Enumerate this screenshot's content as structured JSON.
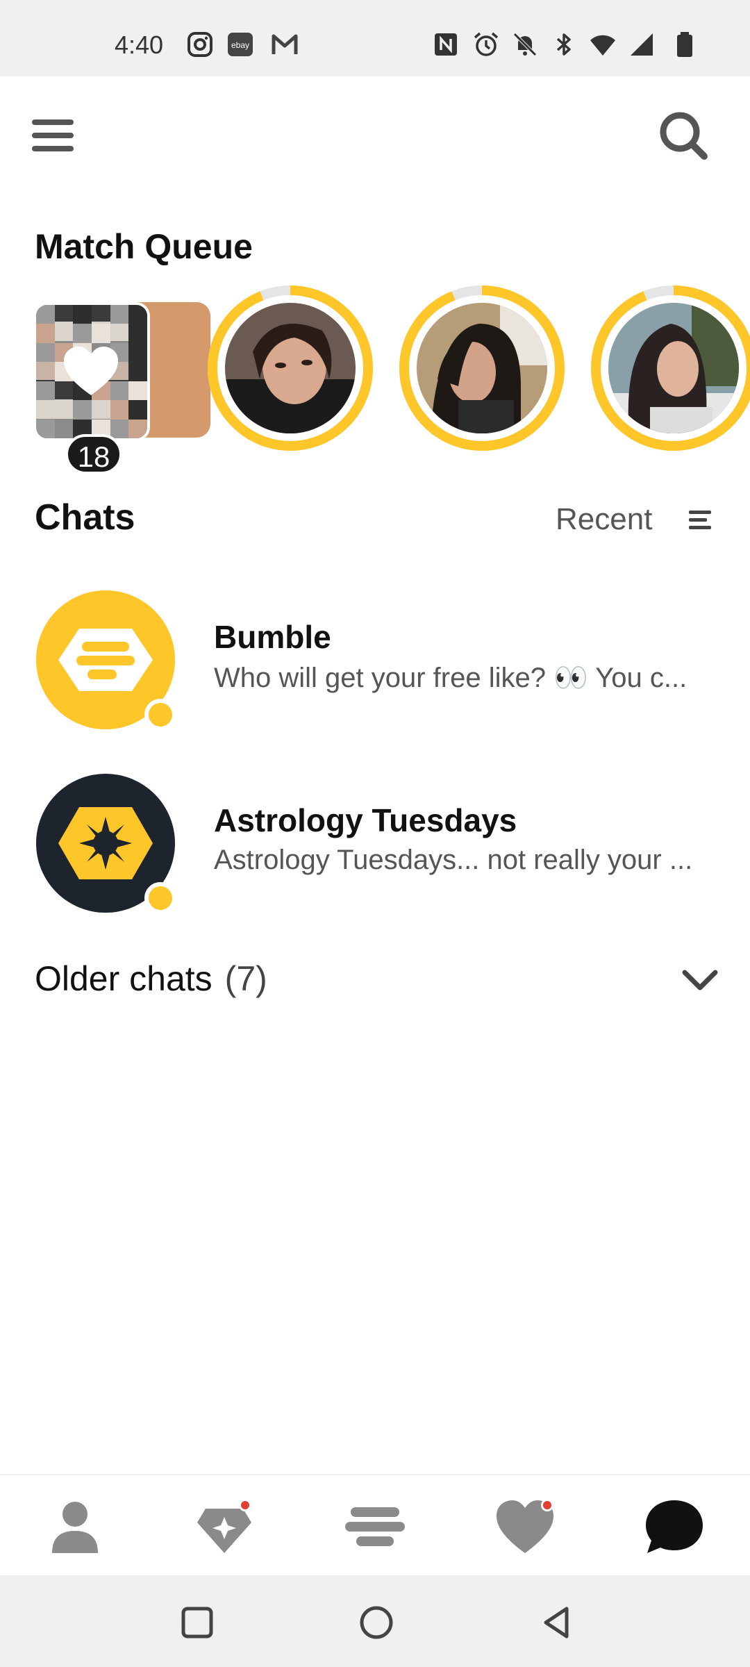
{
  "status_bar": {
    "time": "4:40",
    "left_icons": [
      "instagram-icon",
      "ebay-icon",
      "gmail-icon"
    ],
    "right_icons": [
      "nfc-icon",
      "alarm-icon",
      "notifications-off-icon",
      "bluetooth-icon",
      "wifi-icon",
      "signal-icon",
      "battery-icon"
    ]
  },
  "header": {
    "menu_icon": "hamburger-menu-icon",
    "search_icon": "search-icon"
  },
  "match_queue": {
    "title": "Match Queue",
    "likes_count": "18",
    "matches": [
      {
        "name": "match-1",
        "progress": 0.94
      },
      {
        "name": "match-2",
        "progress": 0.94
      },
      {
        "name": "match-3",
        "progress": 0.94
      }
    ]
  },
  "chats": {
    "title": "Chats",
    "sort_label": "Recent",
    "items": [
      {
        "name": "Bumble",
        "preview": "Who will get your free like? 👀 You c..."
      },
      {
        "name": "Astrology Tuesdays",
        "preview": "Astrology Tuesdays... not really your ..."
      }
    ],
    "older_label": "Older chats",
    "older_count": "(7)"
  },
  "bottom_nav": {
    "items": [
      "profile-icon",
      "premium-icon",
      "discover-icon",
      "liked-you-icon",
      "chats-icon"
    ],
    "active": "chats-icon"
  },
  "colors": {
    "accent": "#ffc629",
    "dark": "#1d242e",
    "badge": "#e0402f"
  }
}
